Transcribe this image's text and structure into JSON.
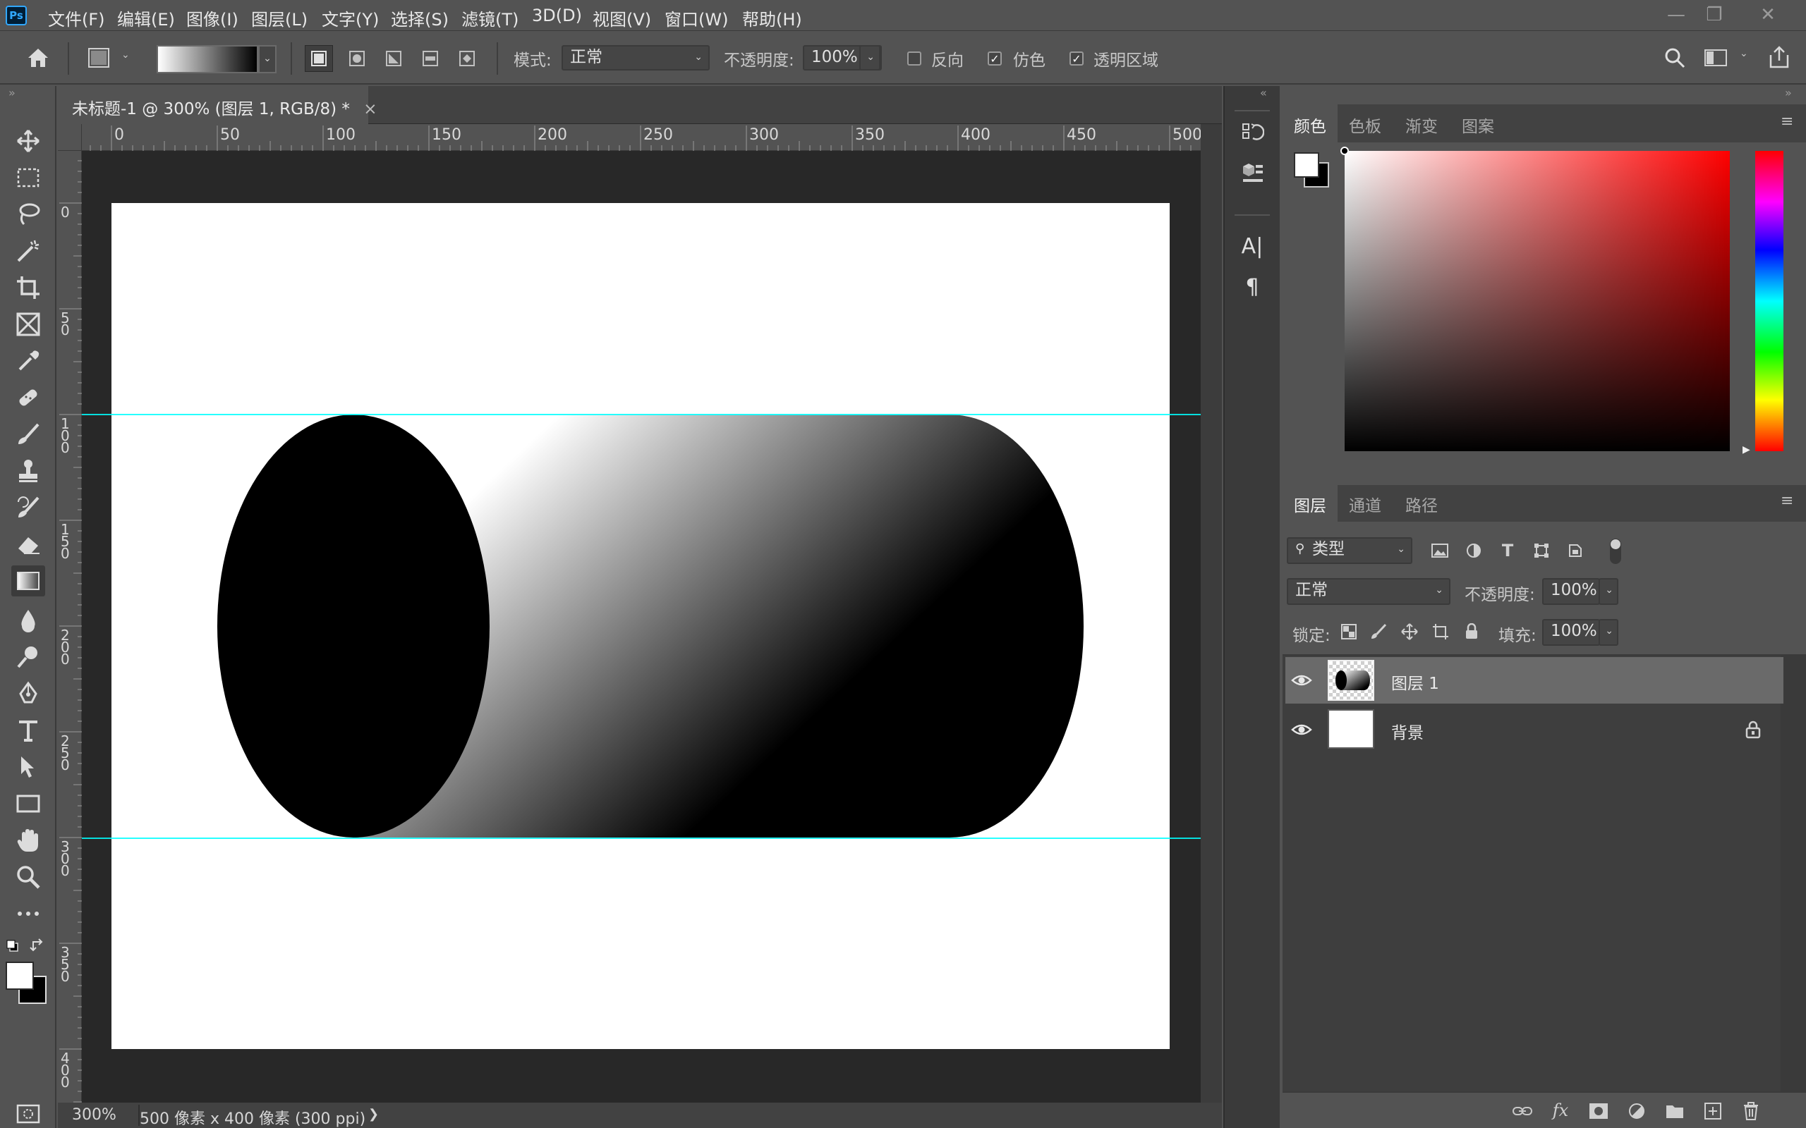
{
  "app": {
    "logo": "Ps"
  },
  "menu": [
    "文件(F)",
    "编辑(E)",
    "图像(I)",
    "图层(L)",
    "文字(Y)",
    "选择(S)",
    "滤镜(T)",
    "3D(D)",
    "视图(V)",
    "窗口(W)",
    "帮助(H)"
  ],
  "window_controls": {
    "minimize": "—",
    "restore": "❐",
    "close": "✕"
  },
  "options": {
    "mode_label": "模式:",
    "mode_value": "正常",
    "opacity_label": "不透明度:",
    "opacity_value": "100%",
    "reverse_label": "反向",
    "reverse_checked": false,
    "dither_label": "仿色",
    "dither_checked": true,
    "transparency_label": "透明区域",
    "transparency_checked": true
  },
  "document": {
    "tab_title": "未标题-1 @ 300% (图层 1, RGB/8) *",
    "close": "×",
    "zoom": "300%",
    "info": "500 像素 x 400 像素 (300 ppi)",
    "info_arrow": "❯"
  },
  "ruler": {
    "h_labels": [
      "0",
      "50",
      "100",
      "150",
      "200",
      "250",
      "300",
      "350",
      "400",
      "450",
      "500"
    ],
    "v_labels": [
      [
        "0"
      ],
      [
        "5",
        "0"
      ],
      [
        "1",
        "0",
        "0"
      ],
      [
        "1",
        "5",
        "0"
      ],
      [
        "2",
        "0",
        "0"
      ],
      [
        "2",
        "5",
        "0"
      ],
      [
        "3",
        "0",
        "0"
      ],
      [
        "3",
        "5",
        "0"
      ],
      [
        "4",
        "0",
        "0"
      ]
    ]
  },
  "color_panel": {
    "tabs": [
      "颜色",
      "色板",
      "渐变",
      "图案"
    ],
    "foreground": "#ffffff",
    "background": "#000000",
    "hue": "#ff0000"
  },
  "layers_panel": {
    "tabs": [
      "图层",
      "通道",
      "路径"
    ],
    "filter_label": "类型",
    "blend_mode": "正常",
    "opacity_label": "不透明度:",
    "opacity_value": "100%",
    "lock_label": "锁定:",
    "fill_label": "填充:",
    "fill_value": "100%",
    "layers": [
      {
        "name": "图层 1",
        "selected": true,
        "visible": true,
        "locked": false
      },
      {
        "name": "背景",
        "selected": false,
        "visible": true,
        "locked": true
      }
    ]
  },
  "colors": {
    "accent": "#31a8ff",
    "guide": "#00ffff",
    "ui_bg": "#535353",
    "pasteboard": "#282828"
  }
}
